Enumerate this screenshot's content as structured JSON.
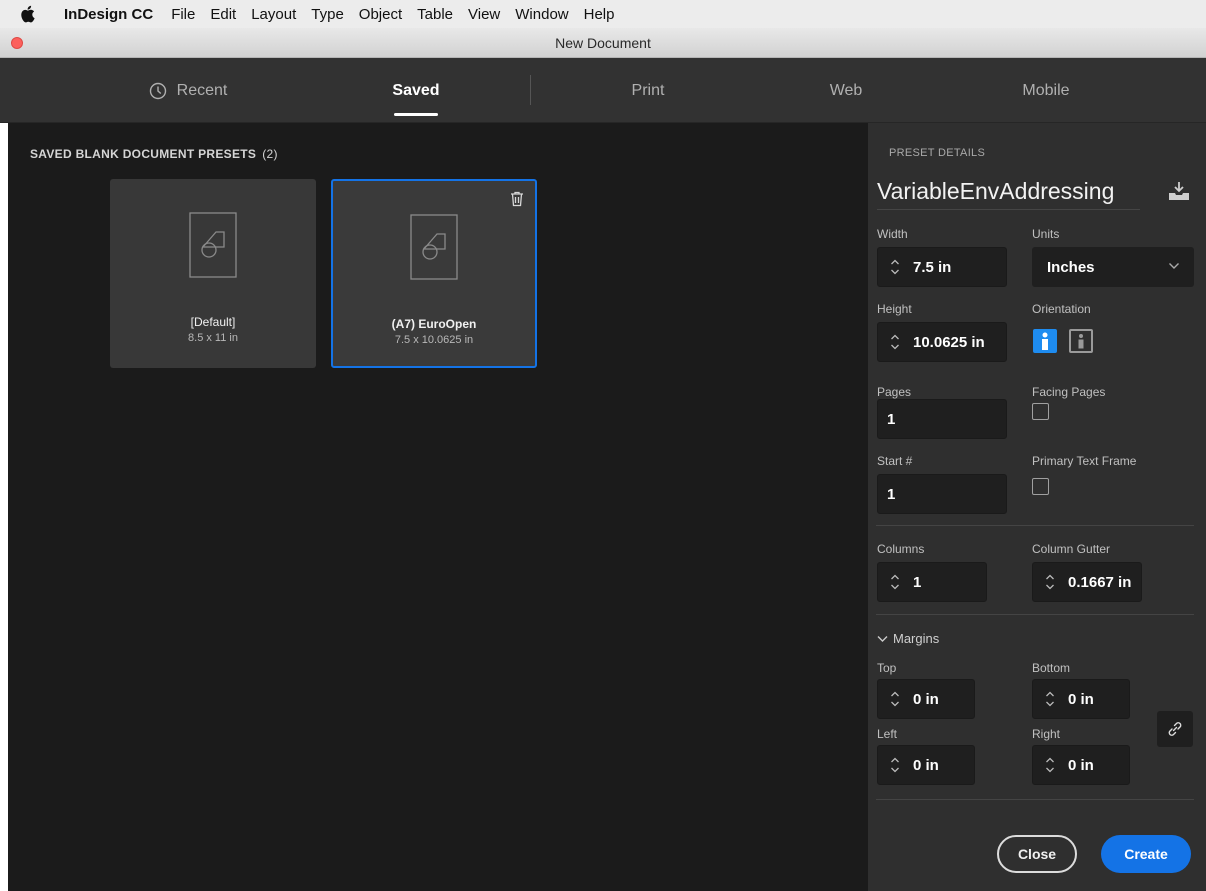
{
  "menubar": {
    "app_name": "InDesign CC",
    "items": [
      "File",
      "Edit",
      "Layout",
      "Type",
      "Object",
      "Table",
      "View",
      "Window",
      "Help"
    ]
  },
  "window": {
    "title": "New Document"
  },
  "tabs": [
    {
      "label": "Recent",
      "icon": "clock-icon"
    },
    {
      "label": "Saved",
      "active": true
    },
    {
      "label": "Print"
    },
    {
      "label": "Web"
    },
    {
      "label": "Mobile"
    }
  ],
  "presets": {
    "heading": "SAVED BLANK DOCUMENT PRESETS",
    "count": "(2)",
    "items": [
      {
        "name": "[Default]",
        "size": "8.5 x 11 in",
        "selected": false
      },
      {
        "name": "(A7) EuroOpen",
        "size": "7.5 x 10.0625 in",
        "selected": true
      }
    ]
  },
  "details": {
    "heading": "PRESET DETAILS",
    "preset_name": "VariableEnvAddressing",
    "width": {
      "label": "Width",
      "value": "7.5 in"
    },
    "units": {
      "label": "Units",
      "value": "Inches"
    },
    "height": {
      "label": "Height",
      "value": "10.0625 in"
    },
    "orientation": {
      "label": "Orientation",
      "selected": "portrait"
    },
    "pages": {
      "label": "Pages",
      "value": "1"
    },
    "facing_pages": {
      "label": "Facing Pages",
      "checked": false
    },
    "start": {
      "label": "Start #",
      "value": "1"
    },
    "primary_text_frame": {
      "label": "Primary Text Frame",
      "checked": false
    },
    "columns": {
      "label": "Columns",
      "value": "1"
    },
    "column_gutter": {
      "label": "Column Gutter",
      "value": "0.1667 in"
    },
    "margins": {
      "label": "Margins",
      "top": {
        "label": "Top",
        "value": "0 in"
      },
      "bottom": {
        "label": "Bottom",
        "value": "0 in"
      },
      "left": {
        "label": "Left",
        "value": "0 in"
      },
      "right": {
        "label": "Right",
        "value": "0 in"
      }
    }
  },
  "buttons": {
    "close": "Close",
    "create": "Create"
  },
  "colors": {
    "accent": "#1473e6",
    "panel": "#2f2f2f",
    "canvas": "#1b1b1b"
  }
}
